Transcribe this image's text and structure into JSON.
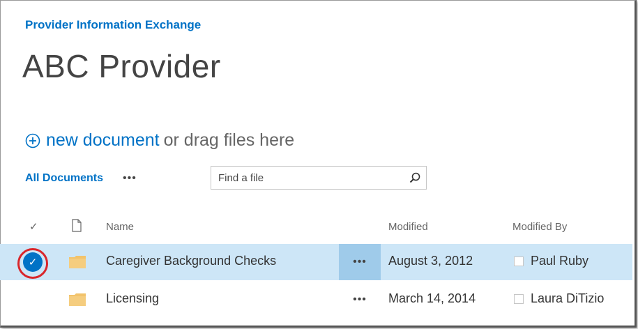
{
  "site": {
    "title": "Provider Information Exchange"
  },
  "page": {
    "title": "ABC Provider"
  },
  "new_document": {
    "link_label": "new document",
    "rest_label": "or drag files here"
  },
  "toolbar": {
    "view_label": "All Documents",
    "ellipsis": "•••",
    "search_placeholder": "Find a file"
  },
  "columns": {
    "check": "✓",
    "name": "Name",
    "modified": "Modified",
    "modified_by": "Modified By"
  },
  "rows": [
    {
      "name": "Caregiver Background Checks",
      "ellipsis": "•••",
      "modified": "August 3, 2012",
      "modified_by": "Paul Ruby",
      "selected": true,
      "check": "✓"
    },
    {
      "name": "Licensing",
      "ellipsis": "•••",
      "modified": "March 14, 2014",
      "modified_by": "Laura DiTizio",
      "selected": false
    }
  ],
  "colors": {
    "accent": "#0072c6",
    "selection": "#cde6f7",
    "annotation": "#d9262b",
    "folder": "#f2c36b"
  },
  "icons": [
    "plus-circle-icon",
    "search-icon",
    "document-icon",
    "folder-icon",
    "checkmark-icon"
  ]
}
